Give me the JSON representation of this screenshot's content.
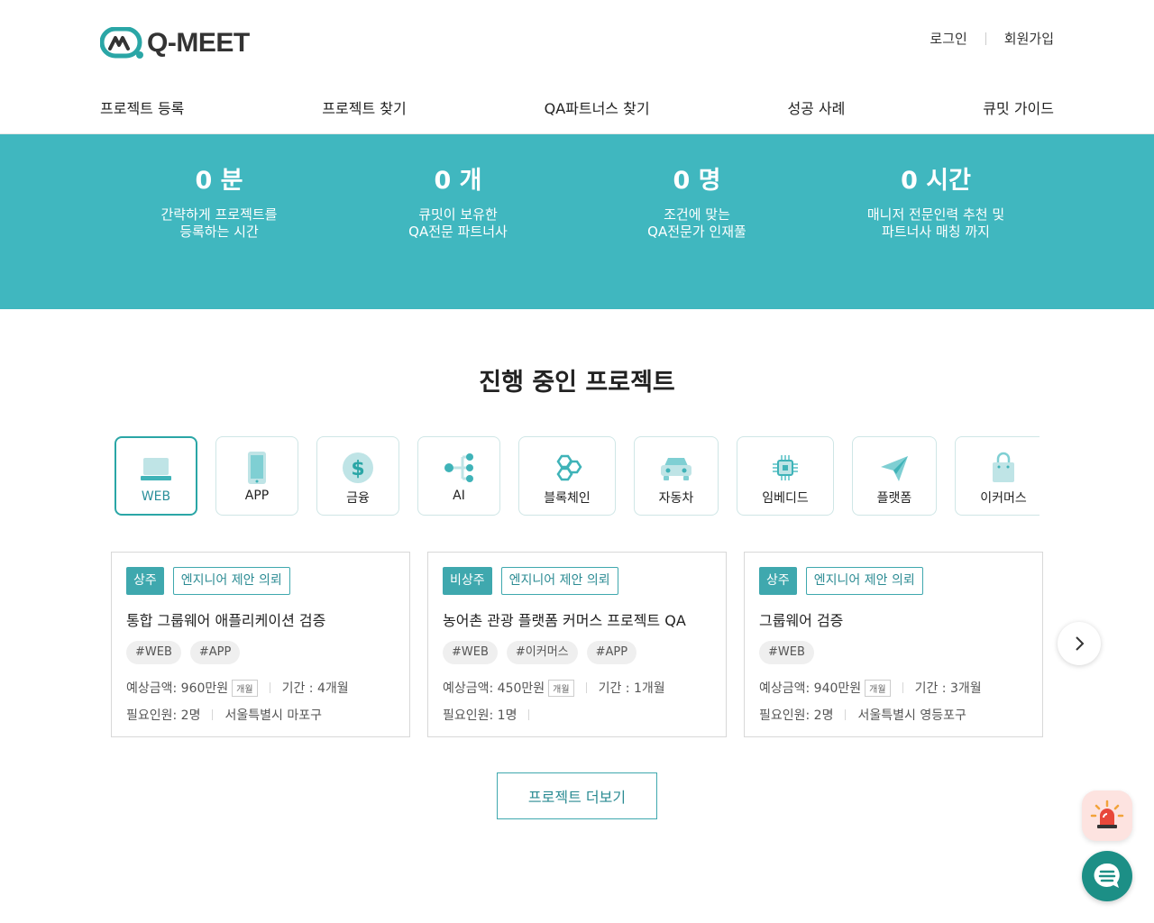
{
  "brand": {
    "name": "Q-MEET",
    "accent": "#40b7bf",
    "accent_dark": "#2aa6a6"
  },
  "auth": {
    "login": "로그인",
    "signup": "회원가입"
  },
  "nav": [
    {
      "label": "프로젝트 등록"
    },
    {
      "label": "프로젝트 찾기"
    },
    {
      "label": "QA파트너스 찾기"
    },
    {
      "label": "성공 사례"
    },
    {
      "label": "큐밋 가이드"
    }
  ],
  "stats": [
    {
      "value": "0 분",
      "line1": "간략하게 프로젝트를",
      "line2": "등록하는 시간"
    },
    {
      "value": "0 개",
      "line1": "큐밋이 보유한",
      "line2": "QA전문 파트너사"
    },
    {
      "value": "0 명",
      "line1": "조건에 맞는",
      "line2": "QA전문가 인재풀"
    },
    {
      "value": "0 시간",
      "line1": "매니저 전문인력 추천 및",
      "line2": "파트너사 매칭 까지"
    }
  ],
  "section_title": "진행 중인 프로젝트",
  "categories": [
    {
      "label": "WEB",
      "icon": "laptop-icon",
      "active": true
    },
    {
      "label": "APP",
      "icon": "smartphone-icon"
    },
    {
      "label": "금융",
      "icon": "dollar-coin-icon"
    },
    {
      "label": "AI",
      "icon": "network-nodes-icon"
    },
    {
      "label": "블록체인",
      "icon": "blockchain-hexagon-icon"
    },
    {
      "label": "자동차",
      "icon": "car-icon"
    },
    {
      "label": "임베디드",
      "icon": "chip-icon"
    },
    {
      "label": "플랫폼",
      "icon": "paper-plane-icon"
    },
    {
      "label": "이커머스",
      "icon": "shopping-bag-icon"
    }
  ],
  "projects": [
    {
      "type": "상주",
      "request": "엔지니어 제안 의뢰",
      "title": "통합 그룹웨어 애플리케이션 검증",
      "tags": [
        "#WEB",
        "#APP"
      ],
      "budget": "예상금액: 960만원",
      "unit": "개월",
      "period": "기간 : 4개월",
      "people": "필요인원: 2명",
      "location": "서울특별시 마포구"
    },
    {
      "type": "비상주",
      "request": "엔지니어 제안 의뢰",
      "title": "농어촌 관광 플랫폼 커머스 프로젝트 QA",
      "tags": [
        "#WEB",
        "#이커머스",
        "#APP"
      ],
      "budget": "예상금액: 450만원",
      "unit": "개월",
      "period": "기간 : 1개월",
      "people": "필요인원: 1명",
      "location": ""
    },
    {
      "type": "상주",
      "request": "엔지니어 제안 의뢰",
      "title": "그룹웨어 검증",
      "tags": [
        "#WEB"
      ],
      "budget": "예상금액: 940만원",
      "unit": "개월",
      "period": "기간 : 3개월",
      "people": "필요인원: 2명",
      "location": "서울특별시 영등포구"
    }
  ],
  "more_button": "프로젝트 더보기",
  "icons": {
    "next": "chevron-right-icon",
    "alarm": "siren-icon",
    "chat": "chat-icon"
  }
}
